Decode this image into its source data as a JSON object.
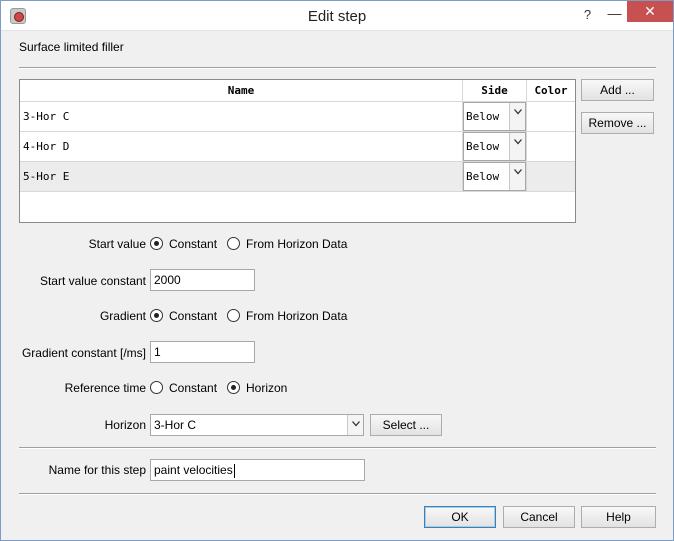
{
  "window": {
    "title": "Edit step",
    "help_glyph": "?",
    "minimize_glyph": "—",
    "close_glyph": "✕"
  },
  "step_type": "Surface limited filler",
  "table": {
    "columns": [
      "Name",
      "Side",
      "Color"
    ],
    "rows": [
      {
        "name": "3-Hor C",
        "side": "Below"
      },
      {
        "name": "4-Hor D",
        "side": "Below"
      },
      {
        "name": "5-Hor E",
        "side": "Below"
      }
    ]
  },
  "buttons": {
    "add": "Add ...",
    "remove": "Remove ...",
    "select": "Select ...",
    "ok": "OK",
    "cancel": "Cancel",
    "help": "Help"
  },
  "start_value": {
    "label": "Start value",
    "option_constant": "Constant",
    "option_horizon_data": "From Horizon Data",
    "selected": "Constant"
  },
  "start_value_constant": {
    "label": "Start value constant",
    "value": "2000"
  },
  "gradient": {
    "label": "Gradient",
    "option_constant": "Constant",
    "option_horizon_data": "From Horizon Data",
    "selected": "Constant"
  },
  "gradient_constant": {
    "label": "Gradient constant [/ms]",
    "value": "1"
  },
  "reference_time": {
    "label": "Reference time",
    "option_constant": "Constant",
    "option_horizon": "Horizon",
    "selected": "Horizon"
  },
  "horizon": {
    "label": "Horizon",
    "value": "3-Hor C"
  },
  "step_name": {
    "label": "Name for this step",
    "value": "paint velocities"
  }
}
